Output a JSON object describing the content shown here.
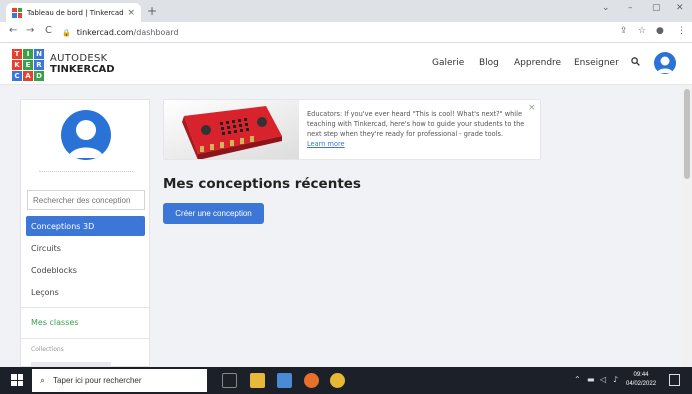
{
  "browser": {
    "tab_title": "Tableau de bord | Tinkercad",
    "tab_close": "×",
    "new_tab": "+",
    "url_domain": "tinkercad.com",
    "url_path": "/dashboard",
    "back": "←",
    "forward": "→",
    "reload": "C",
    "minimize": "⌄",
    "restore": "–",
    "maximize": "▢",
    "close": "✕"
  },
  "header": {
    "logo_letters": [
      "T",
      "I",
      "N",
      "K",
      "E",
      "R",
      "C",
      "A",
      "D"
    ],
    "logo_colors": [
      "#e8402f",
      "#3aa14a",
      "#3c77d7",
      "#e8402f",
      "#3aa14a",
      "#3c77d7",
      "#3c77d7",
      "#e8402f",
      "#3aa14a"
    ],
    "brand_line1": "AUTODESK",
    "brand_line2": "TINKERCAD",
    "nav": [
      "Galerie",
      "Blog",
      "Apprendre",
      "Enseigner"
    ]
  },
  "sidebar": {
    "search_placeholder": "Rechercher des conception",
    "items": [
      {
        "label": "Conceptions 3D",
        "active": true
      },
      {
        "label": "Circuits",
        "active": false
      },
      {
        "label": "Codeblocks",
        "active": false
      },
      {
        "label": "Leçons",
        "active": false
      }
    ],
    "classes": "Mes classes",
    "collections": "Collections"
  },
  "banner": {
    "text": "Educators: If you've ever heard \"This is cool! What's next?\" while teaching with Tinkercad, here's how to guide your students to the next step when they're ready for professional - grade tools.",
    "link": "Learn more",
    "close": "×"
  },
  "main": {
    "heading": "Mes conceptions récentes",
    "create_button": "Créer une conception"
  },
  "taskbar": {
    "search_text": "Taper ici pour rechercher",
    "time": "09:44",
    "date": "04/02/2022"
  },
  "colors": {
    "accent": "#3c77d7",
    "green": "#3aa14a",
    "avatar": "#2a72d6"
  }
}
